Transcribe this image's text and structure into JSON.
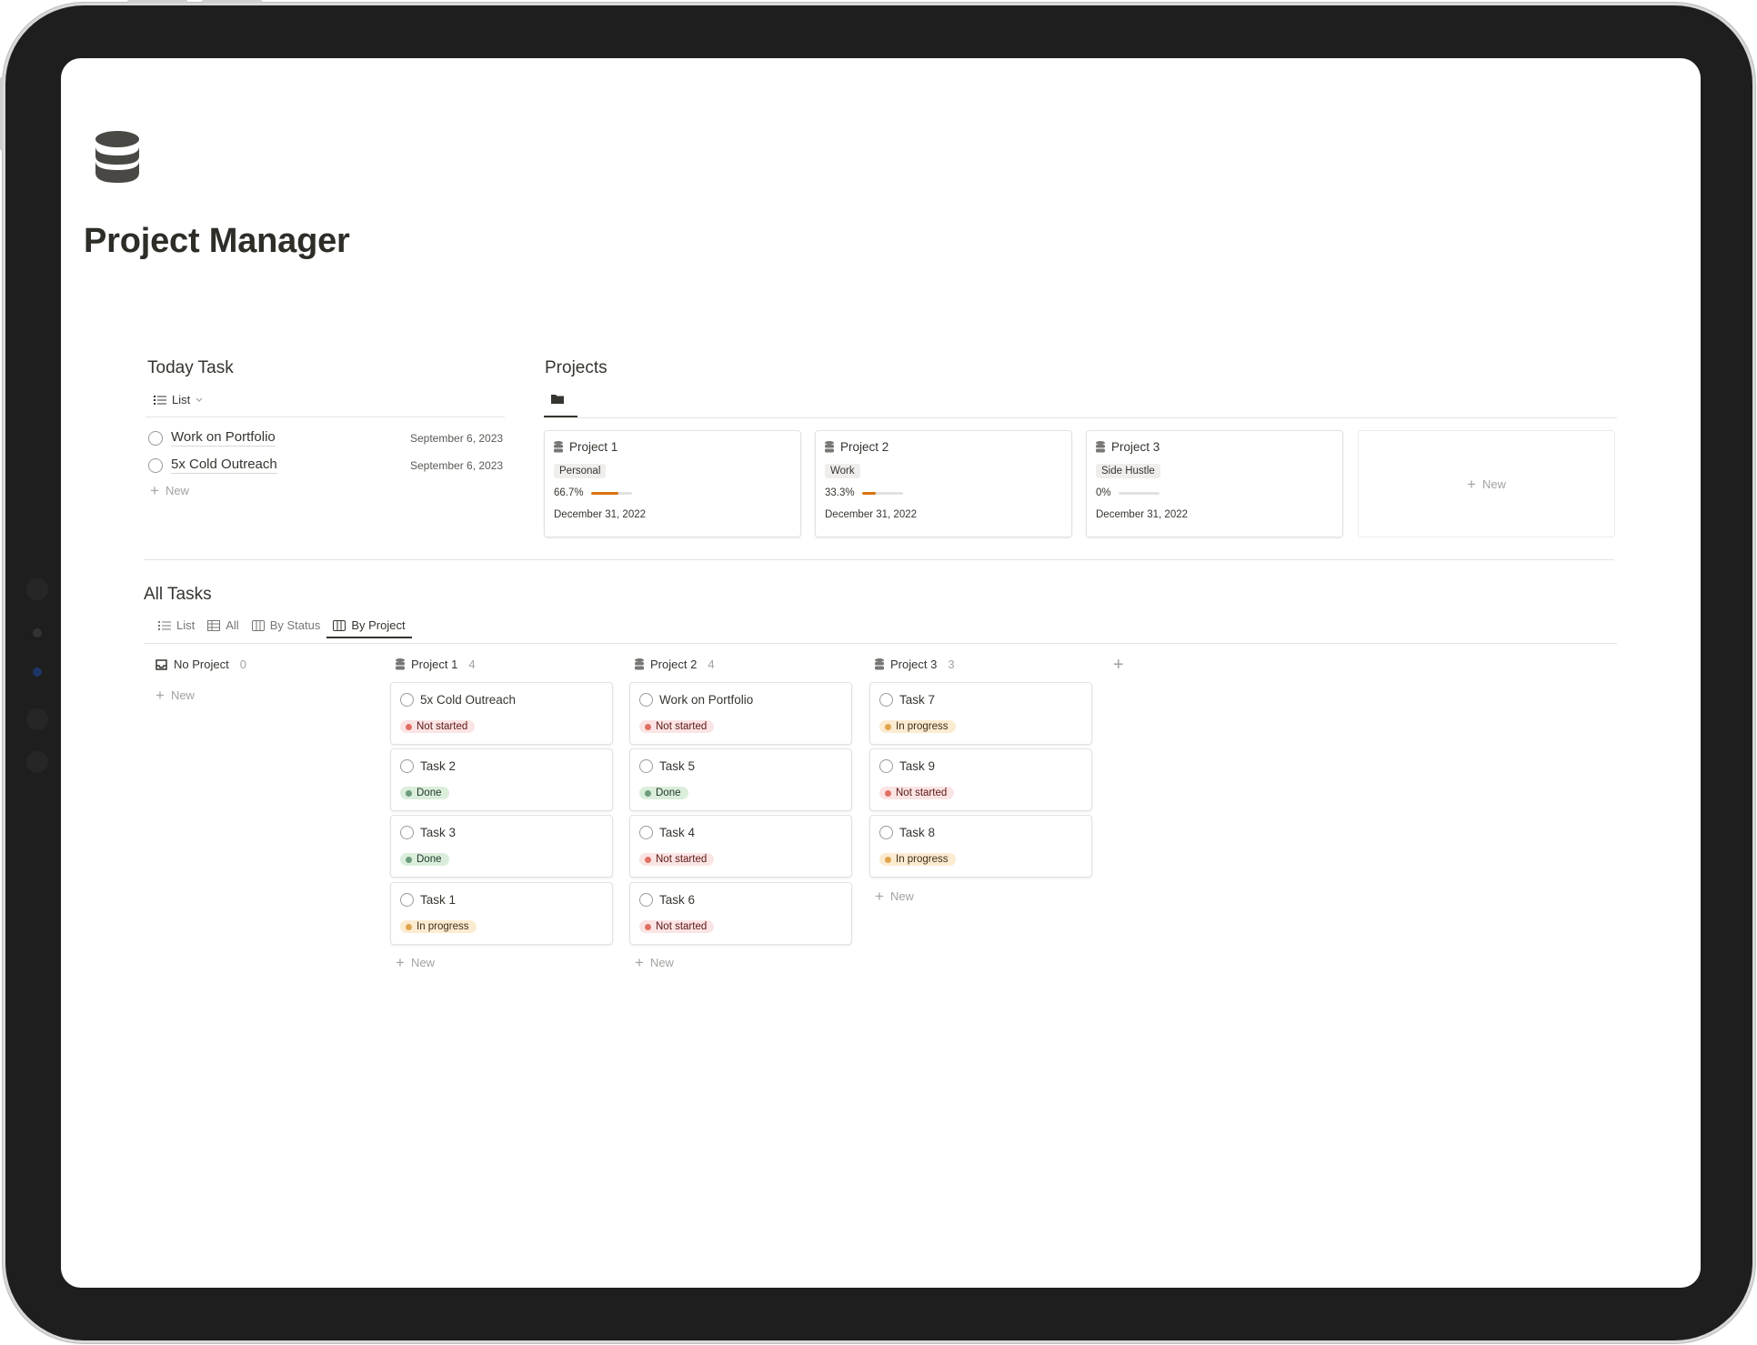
{
  "page": {
    "title": "Project Manager",
    "icon": "database-icon"
  },
  "today_task": {
    "title": "Today Task",
    "view_label": "List",
    "tasks": [
      {
        "name": "Work on Portfolio",
        "date": "September 6, 2023"
      },
      {
        "name": "5x Cold Outreach",
        "date": "September 6, 2023"
      }
    ],
    "new_label": "New"
  },
  "projects": {
    "title": "Projects",
    "view_icon": "folder-icon",
    "cards": [
      {
        "name": "Project 1",
        "tag": "Personal",
        "progress_label": "66.7%",
        "progress": 0.667,
        "date": "December 31, 2022"
      },
      {
        "name": "Project 2",
        "tag": "Work",
        "progress_label": "33.3%",
        "progress": 0.333,
        "date": "December 31, 2022"
      },
      {
        "name": "Project 3",
        "tag": "Side Hustle",
        "progress_label": "0%",
        "progress": 0,
        "date": "December 31, 2022"
      }
    ],
    "new_label": "New",
    "progress_color": "#d9730d"
  },
  "all_tasks": {
    "title": "All Tasks",
    "tabs": [
      {
        "label": "List",
        "icon": "list-icon"
      },
      {
        "label": "All",
        "icon": "table-icon"
      },
      {
        "label": "By Status",
        "icon": "board-icon"
      },
      {
        "label": "By Project",
        "icon": "board-icon",
        "active": true
      }
    ],
    "columns": [
      {
        "name": "No Project",
        "count": "0",
        "icon": "inbox-icon",
        "cards": []
      },
      {
        "name": "Project 1",
        "count": "4",
        "icon": "database-icon",
        "cards": [
          {
            "name": "5x Cold Outreach",
            "status": "Not started"
          },
          {
            "name": "Task 2",
            "status": "Done"
          },
          {
            "name": "Task 3",
            "status": "Done"
          },
          {
            "name": "Task 1",
            "status": "In progress"
          }
        ]
      },
      {
        "name": "Project 2",
        "count": "4",
        "icon": "database-icon",
        "cards": [
          {
            "name": "Work on Portfolio",
            "status": "Not started"
          },
          {
            "name": "Task 5",
            "status": "Done"
          },
          {
            "name": "Task 4",
            "status": "Not started"
          },
          {
            "name": "Task 6",
            "status": "Not started"
          }
        ]
      },
      {
        "name": "Project 3",
        "count": "3",
        "icon": "database-icon",
        "cards": [
          {
            "name": "Task 7",
            "status": "In progress"
          },
          {
            "name": "Task 9",
            "status": "Not started"
          },
          {
            "name": "Task 8",
            "status": "In progress"
          }
        ]
      }
    ],
    "new_label": "New",
    "status_colors": {
      "Not started": "#e16f64",
      "Done": "#6c9b7d",
      "In progress": "#e0a44c"
    }
  }
}
